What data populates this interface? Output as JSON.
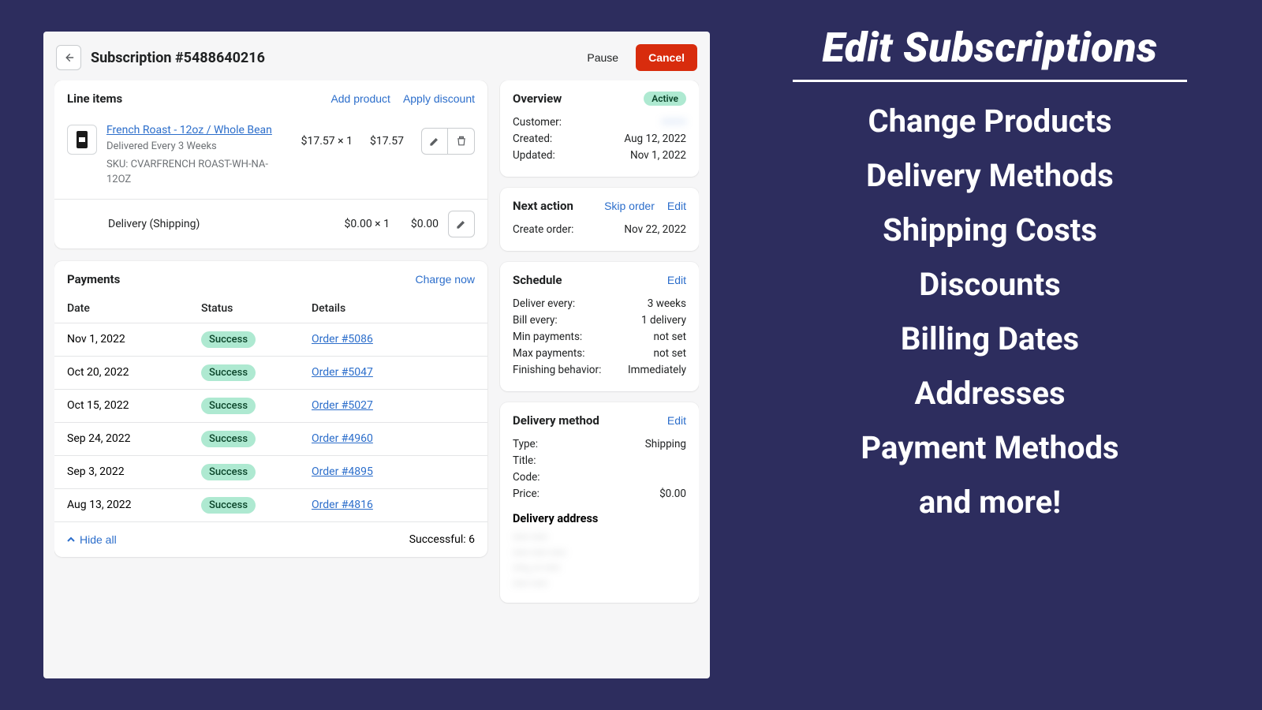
{
  "header": {
    "title": "Subscription #5488640216",
    "pause": "Pause",
    "cancel": "Cancel"
  },
  "lineItems": {
    "title": "Line items",
    "addProduct": "Add product",
    "applyDiscount": "Apply discount",
    "product": {
      "name": "French Roast - 12oz / Whole Bean",
      "cadence": "Delivered Every 3 Weeks",
      "sku": "SKU: CVARFRENCH ROAST-WH-NA-12OZ",
      "unit": "$17.57 × 1",
      "total": "$17.57"
    },
    "shipping": {
      "label": "Delivery (Shipping)",
      "unit": "$0.00 × 1",
      "total": "$0.00"
    }
  },
  "payments": {
    "title": "Payments",
    "chargeNow": "Charge now",
    "cols": {
      "date": "Date",
      "status": "Status",
      "details": "Details"
    },
    "rows": [
      {
        "date": "Nov 1, 2022",
        "status": "Success",
        "order": "Order #5086"
      },
      {
        "date": "Oct 20, 2022",
        "status": "Success",
        "order": "Order #5047"
      },
      {
        "date": "Oct 15, 2022",
        "status": "Success",
        "order": "Order #5027"
      },
      {
        "date": "Sep 24, 2022",
        "status": "Success",
        "order": "Order #4960"
      },
      {
        "date": "Sep 3, 2022",
        "status": "Success",
        "order": "Order #4895"
      },
      {
        "date": "Aug 13, 2022",
        "status": "Success",
        "order": "Order #4816"
      }
    ],
    "hideAll": "Hide all",
    "successful": "Successful: 6"
  },
  "overview": {
    "title": "Overview",
    "status": "Active",
    "customerLabel": "Customer:",
    "customerValue": "———",
    "createdLabel": "Created:",
    "createdValue": "Aug 12, 2022",
    "updatedLabel": "Updated:",
    "updatedValue": "Nov 1, 2022"
  },
  "nextAction": {
    "title": "Next action",
    "skip": "Skip order",
    "edit": "Edit",
    "createLabel": "Create order:",
    "createValue": "Nov 22, 2022"
  },
  "schedule": {
    "title": "Schedule",
    "edit": "Edit",
    "rows": [
      {
        "k": "Deliver every:",
        "v": "3 weeks"
      },
      {
        "k": "Bill every:",
        "v": "1 delivery"
      },
      {
        "k": "Min payments:",
        "v": "not set"
      },
      {
        "k": "Max payments:",
        "v": "not set"
      },
      {
        "k": "Finishing behavior:",
        "v": "Immediately"
      }
    ]
  },
  "delivery": {
    "title": "Delivery method",
    "edit": "Edit",
    "rows": [
      {
        "k": "Type:",
        "v": "Shipping"
      },
      {
        "k": "Title:",
        "v": ""
      },
      {
        "k": "Code:",
        "v": ""
      },
      {
        "k": "Price:",
        "v": "$0.00"
      }
    ],
    "addressTitle": "Delivery address",
    "address": [
      "—— ——",
      "—— —— ——",
      "——, — ——",
      "—— ——"
    ]
  },
  "marketing": {
    "title": "Edit Subscriptions",
    "items": [
      "Change Products",
      "Delivery Methods",
      "Shipping Costs",
      "Discounts",
      "Billing Dates",
      "Addresses",
      "Payment Methods",
      "and more!"
    ]
  }
}
